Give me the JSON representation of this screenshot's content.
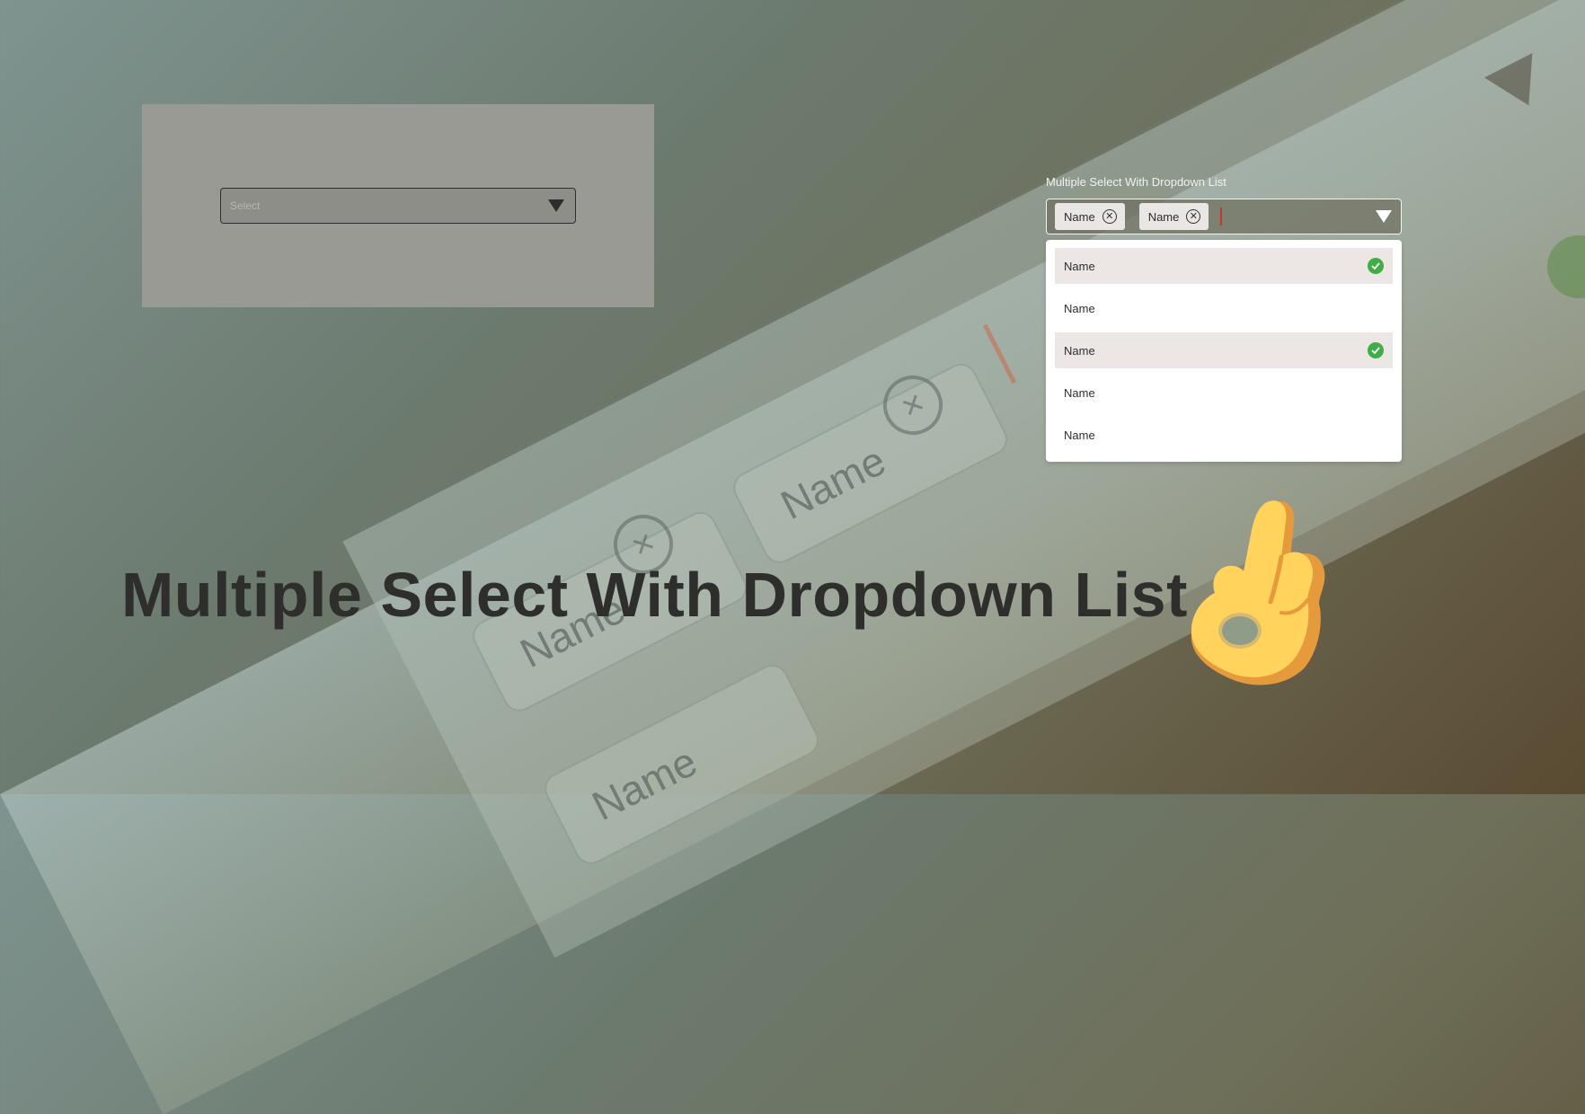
{
  "left_card": {
    "select_placeholder": "Select"
  },
  "widget": {
    "label": "Multiple Select With Dropdown List",
    "chips": [
      {
        "label": "Name"
      },
      {
        "label": "Name"
      }
    ],
    "options": [
      {
        "label": "Name",
        "selected": true
      },
      {
        "label": "Name",
        "selected": false
      },
      {
        "label": "Name",
        "selected": true
      },
      {
        "label": "Name",
        "selected": false
      },
      {
        "label": "Name",
        "selected": false
      }
    ]
  },
  "headline": "Multiple Select With Dropdown List",
  "background": {
    "chips": [
      "Name",
      "Name",
      "Name"
    ]
  },
  "colors": {
    "check_green": "#3fae49",
    "selected_row": "#ece6e5",
    "caret_red": "#c0392b",
    "headline": "#2e2e2d"
  },
  "icons": [
    "chevron-down-icon",
    "close-circle-icon",
    "check-circle-icon",
    "ok-hand-emoji"
  ]
}
